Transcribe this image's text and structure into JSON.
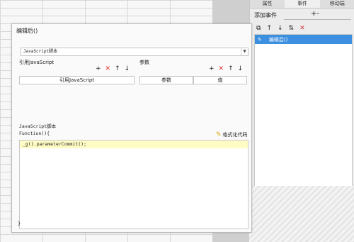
{
  "right_panel": {
    "tabs": [
      "属性",
      "事件",
      "移动端"
    ],
    "add_event_label": "添加事件",
    "add_event_plus": "+-",
    "toolbar_icons": [
      "copy-icon",
      "arrow-up-icon",
      "arrow-down-icon",
      "move-icon",
      "close-icon"
    ],
    "event_item": "编辑后()"
  },
  "dialog": {
    "title": "编辑后()",
    "script_type": "JavaScript脚本",
    "ref_js_label": "引用JavaScript",
    "params_label": "参数",
    "col_ref_js": "引用JavaScript",
    "col_param": "参数",
    "col_value": "值",
    "script_section_label": "JavaScript脚本",
    "function_sig": "Function(){",
    "format_label": "格式化代码",
    "code_line": "_g().parameterCommit();",
    "closing": "}"
  }
}
